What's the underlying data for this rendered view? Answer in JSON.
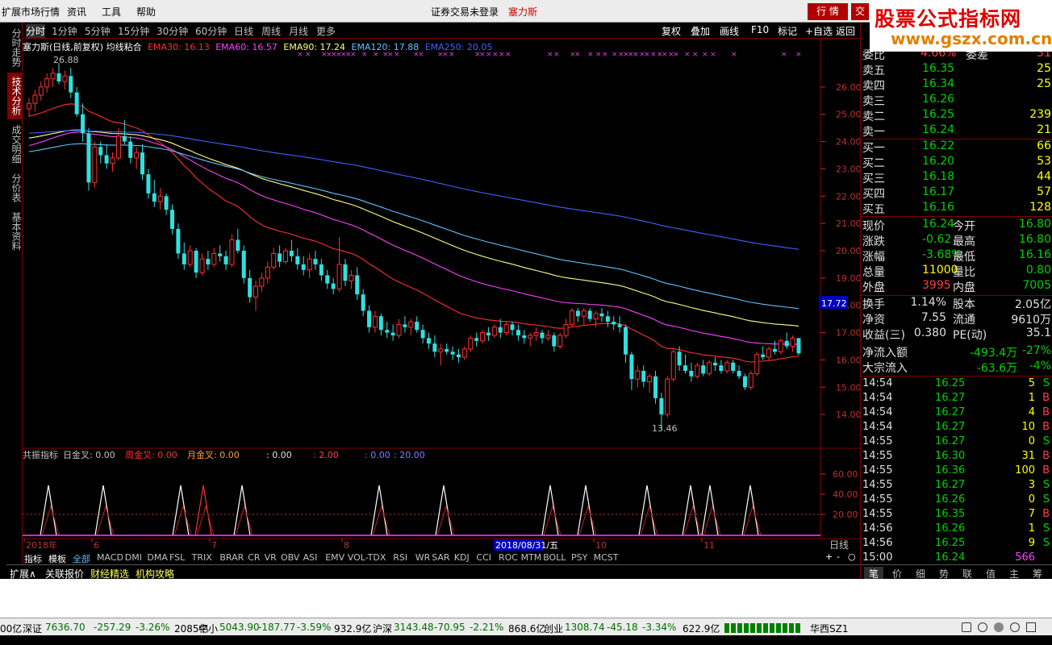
{
  "menu": {
    "items": [
      "扩展市场行情",
      "资讯",
      "工具",
      "帮助"
    ],
    "status": "证券交易未登录",
    "stock": "塞力斯"
  },
  "top_buttons": {
    "trade": "行 情",
    "cut": "交"
  },
  "watermark": {
    "title": "股票公式指标网",
    "url": "www.gszx.com.cn"
  },
  "left_tabs": [
    "分时走势",
    "技术分析",
    "成交明细",
    "分价表",
    "基本资料"
  ],
  "period_bar": {
    "periods": [
      "分时",
      "1分钟",
      "5分钟",
      "15分钟",
      "30分钟",
      "60分钟",
      "日线",
      "周线",
      "月线",
      "更多"
    ],
    "tools": [
      "复权",
      "叠加",
      "画线",
      "F10",
      "标记",
      "+自选",
      "返回"
    ]
  },
  "main_title": "塞力斯(日线,前复权) 均线粘合",
  "ema_labels": [
    "EMA30: 16.13",
    "EMA60: 16.57",
    "EMA90: 17.24",
    "EMA120: 17.88",
    "EMA250: 20.05"
  ],
  "ema_colors": [
    "#ff3030",
    "#ff40ff",
    "#ffff80",
    "#60c0ff",
    "#4060ff"
  ],
  "price_axis": [
    "26.00",
    "25.00",
    "24.00",
    "23.00",
    "22.00",
    "21.00",
    "20.00",
    "19.00",
    "18.00",
    "17.00",
    "16.00",
    "15.00",
    "14.00"
  ],
  "current_price_tag": "17.72",
  "annotations": {
    "high": "26.88",
    "low": "13.46"
  },
  "sub_indicator": {
    "name": "共振指标",
    "day": "日金叉: 0.00",
    "week": "周金叉: 0.00",
    "month": "月金叉: 0.00",
    "v1": ": 0.00",
    "v2": ": 2.00",
    "v3": ": 0.00",
    "v4": ": 20.00"
  },
  "sub_axis": [
    "60.00",
    "40.00",
    "20.00"
  ],
  "date_axis": [
    "2018年",
    "6",
    "7",
    "8",
    "10",
    "11"
  ],
  "date_cursor": "2018/08/31/五",
  "day_label": "日线",
  "nav_buttons": [
    "+",
    "-",
    "○"
  ],
  "index_tabs": [
    "指标",
    "模板",
    "全部",
    "MACD",
    "DMI",
    "DMA",
    "FSL",
    "TRIX",
    "BRAR",
    "CR",
    "VR",
    "OBV",
    "ASI",
    "EMV",
    "VOL-TDX",
    "RSI",
    "WR",
    "SAR",
    "KDJ",
    "CCI",
    "ROC",
    "MTM",
    "BOLL",
    "PSY",
    "MCST"
  ],
  "bottom_tabs": [
    "扩展∧",
    "关联报价",
    "财经精选",
    "机构攻略"
  ],
  "order_book": {
    "ratio": {
      "label": "委比",
      "value": "4.66%",
      "diff_label": "委差",
      "diff": "31"
    },
    "asks": [
      {
        "label": "卖五",
        "price": "16.35",
        "vol": "25"
      },
      {
        "label": "卖四",
        "price": "16.34",
        "vol": "25"
      },
      {
        "label": "卖三",
        "price": "16.26",
        "vol": ""
      },
      {
        "label": "卖二",
        "price": "16.25",
        "vol": "239"
      },
      {
        "label": "卖一",
        "price": "16.24",
        "vol": "21"
      }
    ],
    "bids": [
      {
        "label": "买一",
        "price": "16.22",
        "vol": "66"
      },
      {
        "label": "买二",
        "price": "16.20",
        "vol": "53"
      },
      {
        "label": "买三",
        "price": "16.18",
        "vol": "44"
      },
      {
        "label": "买四",
        "price": "16.17",
        "vol": "57"
      },
      {
        "label": "买五",
        "price": "16.16",
        "vol": "128"
      }
    ]
  },
  "quote": [
    {
      "l1": "现价",
      "v1": "16.24",
      "l2": "今开",
      "v2": "16.80"
    },
    {
      "l1": "涨跌",
      "v1": "-0.62",
      "l2": "最高",
      "v2": "16.80"
    },
    {
      "l1": "涨幅",
      "v1": "-3.68%",
      "l2": "最低",
      "v2": "16.16"
    },
    {
      "l1": "总量",
      "v1": "11000",
      "l2": "量比",
      "v2": "0.80"
    },
    {
      "l1": "外盘",
      "v1": "3995",
      "l2": "内盘",
      "v2": "7005"
    }
  ],
  "fundamentals": [
    {
      "l1": "换手",
      "v1": "1.14%",
      "l2": "股本",
      "v2": "2.05亿"
    },
    {
      "l1": "净资",
      "v1": "7.55",
      "l2": "流通",
      "v2": "9610万"
    },
    {
      "l1": "收益(三)",
      "v1": "0.380",
      "l2": "PE(动)",
      "v2": "35.1"
    }
  ],
  "flows": [
    {
      "label": "净流入额",
      "value": "-493.4万",
      "pct": "-27%"
    },
    {
      "label": "大宗流入",
      "value": "-63.6万",
      "pct": "-4%"
    }
  ],
  "ticks": [
    {
      "t": "14:54",
      "p": "16.25",
      "v": "5",
      "s": "S"
    },
    {
      "t": "14:54",
      "p": "16.27",
      "v": "1",
      "s": "B"
    },
    {
      "t": "14:54",
      "p": "16.27",
      "v": "4",
      "s": "B"
    },
    {
      "t": "14:54",
      "p": "16.27",
      "v": "10",
      "s": "B"
    },
    {
      "t": "14:55",
      "p": "16.27",
      "v": "0",
      "s": "S"
    },
    {
      "t": "14:55",
      "p": "16.30",
      "v": "31",
      "s": "B"
    },
    {
      "t": "14:55",
      "p": "16.36",
      "v": "100",
      "s": "B"
    },
    {
      "t": "14:55",
      "p": "16.27",
      "v": "3",
      "s": "S"
    },
    {
      "t": "14:55",
      "p": "16.26",
      "v": "0",
      "s": "S"
    },
    {
      "t": "14:55",
      "p": "16.35",
      "v": "7",
      "s": "B"
    },
    {
      "t": "14:56",
      "p": "16.26",
      "v": "1",
      "s": "S"
    },
    {
      "t": "14:56",
      "p": "16.25",
      "v": "9",
      "s": "S"
    },
    {
      "t": "15:00",
      "p": "16.24",
      "v": "566",
      "s": ""
    }
  ],
  "right_tabs": [
    "笔",
    "价",
    "细",
    "势",
    "联",
    "值",
    "主",
    "筹"
  ],
  "status_bar": {
    "sz_cut": "00亿",
    "sz": {
      "label": "深证",
      "value": "7636.70",
      "chg": "-257.29",
      "pct": "-3.26%",
      "amt": "2085亿"
    },
    "zx": {
      "label": "中小",
      "value": "5043.90",
      "chg": "-187.77",
      "pct": "-3.59%",
      "amt": "932.9亿"
    },
    "hs": {
      "label": "沪深",
      "value": "3143.48",
      "chg": "-70.95",
      "pct": "-2.21%",
      "amt": "868.6亿"
    },
    "cy": {
      "label": "创业",
      "value": "1308.74",
      "chg": "-45.18",
      "pct": "-3.34%",
      "amt": "622.9亿"
    },
    "broker": "华西SZ1"
  },
  "chart_data": {
    "type": "candlestick",
    "title": "塞力斯(日线,前复权) 均线粘合",
    "ylim": [
      13.0,
      27.0
    ],
    "ohlc": [
      [
        25.2,
        25.6,
        24.9,
        25.4
      ],
      [
        25.4,
        25.9,
        25.1,
        25.7
      ],
      [
        25.7,
        26.2,
        25.5,
        26.0
      ],
      [
        26.0,
        26.5,
        25.8,
        26.3
      ],
      [
        26.3,
        26.7,
        26.0,
        26.5
      ],
      [
        26.5,
        26.88,
        26.1,
        26.2
      ],
      [
        26.2,
        26.6,
        25.9,
        26.4
      ],
      [
        26.4,
        26.7,
        25.6,
        25.8
      ],
      [
        25.8,
        26.0,
        24.9,
        25.0
      ],
      [
        25.0,
        25.4,
        24.0,
        24.3
      ],
      [
        24.3,
        24.5,
        22.2,
        22.5
      ],
      [
        22.5,
        24.0,
        22.3,
        23.8
      ],
      [
        23.8,
        24.0,
        23.2,
        23.5
      ],
      [
        23.5,
        23.9,
        23.0,
        23.2
      ],
      [
        23.2,
        23.6,
        22.9,
        23.4
      ],
      [
        23.4,
        24.5,
        23.3,
        24.2
      ],
      [
        24.2,
        24.8,
        23.9,
        24.0
      ],
      [
        24.0,
        24.2,
        23.2,
        23.4
      ],
      [
        23.4,
        23.8,
        23.0,
        23.6
      ],
      [
        23.6,
        23.9,
        22.6,
        22.8
      ],
      [
        22.8,
        23.0,
        21.9,
        22.1
      ],
      [
        22.1,
        22.6,
        21.6,
        21.8
      ],
      [
        21.8,
        22.3,
        21.5,
        22.0
      ],
      [
        22.0,
        22.1,
        21.3,
        21.5
      ],
      [
        21.5,
        21.7,
        20.6,
        20.8
      ],
      [
        20.8,
        21.0,
        19.7,
        19.9
      ],
      [
        19.9,
        20.3,
        19.3,
        19.5
      ],
      [
        19.5,
        20.2,
        19.4,
        20.0
      ],
      [
        20.0,
        20.1,
        19.0,
        19.2
      ],
      [
        19.2,
        19.9,
        19.1,
        19.7
      ],
      [
        19.7,
        20.0,
        19.3,
        19.5
      ],
      [
        19.5,
        20.1,
        19.4,
        19.9
      ],
      [
        19.9,
        20.2,
        19.6,
        19.8
      ],
      [
        19.8,
        20.0,
        19.3,
        19.5
      ],
      [
        19.5,
        20.6,
        19.4,
        20.4
      ],
      [
        20.4,
        20.8,
        19.9,
        20.0
      ],
      [
        20.0,
        20.2,
        18.8,
        19.0
      ],
      [
        19.0,
        19.3,
        18.1,
        18.3
      ],
      [
        18.3,
        18.9,
        17.8,
        18.7
      ],
      [
        18.7,
        19.2,
        18.5,
        19.0
      ],
      [
        19.0,
        19.6,
        18.8,
        19.4
      ],
      [
        19.4,
        20.1,
        19.3,
        19.9
      ],
      [
        19.9,
        20.2,
        19.4,
        19.6
      ],
      [
        19.6,
        20.1,
        19.5,
        20.0
      ],
      [
        20.0,
        20.4,
        19.6,
        19.8
      ],
      [
        19.8,
        20.1,
        19.3,
        19.5
      ],
      [
        19.5,
        19.8,
        19.1,
        19.3
      ],
      [
        19.3,
        19.9,
        19.0,
        19.7
      ],
      [
        19.7,
        20.0,
        19.3,
        19.5
      ],
      [
        19.5,
        19.7,
        18.9,
        19.1
      ],
      [
        19.1,
        19.3,
        18.6,
        18.8
      ],
      [
        18.8,
        19.0,
        18.4,
        18.6
      ],
      [
        18.6,
        20.5,
        18.5,
        19.5
      ],
      [
        19.5,
        19.7,
        18.7,
        18.9
      ],
      [
        18.9,
        19.3,
        18.6,
        19.1
      ],
      [
        19.1,
        19.4,
        18.2,
        18.4
      ],
      [
        18.4,
        18.6,
        17.6,
        17.8
      ],
      [
        17.8,
        18.0,
        17.0,
        17.2
      ],
      [
        17.2,
        17.8,
        17.0,
        17.6
      ],
      [
        17.6,
        17.7,
        16.9,
        17.1
      ],
      [
        17.1,
        17.4,
        16.8,
        17.0
      ],
      [
        17.0,
        17.3,
        16.7,
        16.9
      ],
      [
        16.9,
        17.5,
        16.8,
        17.3
      ],
      [
        17.3,
        17.6,
        17.0,
        17.2
      ],
      [
        17.2,
        17.5,
        16.9,
        17.4
      ],
      [
        17.4,
        17.6,
        17.0,
        17.1
      ],
      [
        17.1,
        17.3,
        16.6,
        16.8
      ],
      [
        16.8,
        17.0,
        16.4,
        16.6
      ],
      [
        16.6,
        16.9,
        16.1,
        16.3
      ],
      [
        16.3,
        16.6,
        15.8,
        16.4
      ],
      [
        16.4,
        16.6,
        16.2,
        16.3
      ],
      [
        16.3,
        16.5,
        16.0,
        16.2
      ],
      [
        16.2,
        16.4,
        15.9,
        16.1
      ],
      [
        16.1,
        16.5,
        16.0,
        16.4
      ],
      [
        16.4,
        16.9,
        16.3,
        16.8
      ],
      [
        16.8,
        17.0,
        16.5,
        16.7
      ],
      [
        16.7,
        17.1,
        16.6,
        17.0
      ],
      [
        17.0,
        17.2,
        16.7,
        16.9
      ],
      [
        16.9,
        17.3,
        16.8,
        17.2
      ],
      [
        17.2,
        17.5,
        16.8,
        17.0
      ],
      [
        17.0,
        17.4,
        16.9,
        17.3
      ],
      [
        17.3,
        17.4,
        16.9,
        17.1
      ],
      [
        17.1,
        17.3,
        16.7,
        16.9
      ],
      [
        16.9,
        17.1,
        16.6,
        16.8
      ],
      [
        16.8,
        17.0,
        16.5,
        16.9
      ],
      [
        16.9,
        17.2,
        16.7,
        17.0
      ],
      [
        17.0,
        17.1,
        16.6,
        16.8
      ],
      [
        16.8,
        17.1,
        16.7,
        16.9
      ],
      [
        16.9,
        17.0,
        16.3,
        16.5
      ],
      [
        16.5,
        17.0,
        16.4,
        16.9
      ],
      [
        16.9,
        17.5,
        16.8,
        17.3
      ],
      [
        17.3,
        17.9,
        17.2,
        17.8
      ],
      [
        17.8,
        17.9,
        17.4,
        17.6
      ],
      [
        17.6,
        17.9,
        17.3,
        17.8
      ],
      [
        17.8,
        17.9,
        17.4,
        17.5
      ],
      [
        17.5,
        17.8,
        17.2,
        17.7
      ],
      [
        17.7,
        17.9,
        17.4,
        17.6
      ],
      [
        17.6,
        17.8,
        17.2,
        17.4
      ],
      [
        17.4,
        17.6,
        17.1,
        17.3
      ],
      [
        17.3,
        17.6,
        17.0,
        17.2
      ],
      [
        17.2,
        17.3,
        15.9,
        16.2
      ],
      [
        16.2,
        16.3,
        14.9,
        15.3
      ],
      [
        15.3,
        15.8,
        15.0,
        15.6
      ],
      [
        15.6,
        15.8,
        15.0,
        15.2
      ],
      [
        15.2,
        15.5,
        14.8,
        15.4
      ],
      [
        15.4,
        15.6,
        14.4,
        14.6
      ],
      [
        14.6,
        14.8,
        13.46,
        14.0
      ],
      [
        14.0,
        15.4,
        13.9,
        15.3
      ],
      [
        15.3,
        16.4,
        15.2,
        16.3
      ],
      [
        16.3,
        16.5,
        15.6,
        15.8
      ],
      [
        15.8,
        16.2,
        15.5,
        15.6
      ],
      [
        15.6,
        15.9,
        15.2,
        15.4
      ],
      [
        15.4,
        15.9,
        15.3,
        15.8
      ],
      [
        15.8,
        16.0,
        15.4,
        15.5
      ],
      [
        15.5,
        16.0,
        15.4,
        15.9
      ],
      [
        15.9,
        16.1,
        15.6,
        15.8
      ],
      [
        15.8,
        16.0,
        15.5,
        15.6
      ],
      [
        15.6,
        16.0,
        15.5,
        15.9
      ],
      [
        15.9,
        16.0,
        15.5,
        15.6
      ],
      [
        15.6,
        15.8,
        15.3,
        15.4
      ],
      [
        15.4,
        15.5,
        14.9,
        15.0
      ],
      [
        15.0,
        15.6,
        14.9,
        15.5
      ],
      [
        15.5,
        16.3,
        15.4,
        16.2
      ],
      [
        16.2,
        16.5,
        16.0,
        16.1
      ],
      [
        16.1,
        16.5,
        16.0,
        16.4
      ],
      [
        16.4,
        16.7,
        16.2,
        16.3
      ],
      [
        16.3,
        16.8,
        16.2,
        16.7
      ],
      [
        16.7,
        17.0,
        16.4,
        16.5
      ],
      [
        16.5,
        16.9,
        16.3,
        16.8
      ],
      [
        16.8,
        16.8,
        16.16,
        16.24
      ]
    ]
  }
}
